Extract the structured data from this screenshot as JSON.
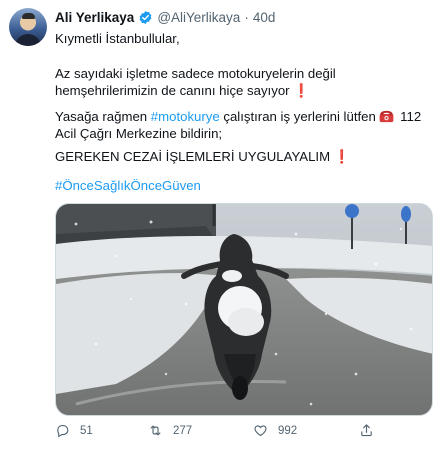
{
  "author": {
    "name": "Ali Yerlikaya",
    "handle": "@AliYerlikaya",
    "separator": "·",
    "time": "40d"
  },
  "tweet": {
    "greeting": "Kıymetli İstanbullular,",
    "para1": "Az sayıdaki işletme sadece motokuryelerin değil hemşehrilerimizin de canını hiçe sayıyor",
    "para2_pre": "Yasağa rağmen ",
    "para2_tag": "#motokurye",
    "para2_mid": " çalıştıran iş yerlerini lütfen ",
    "para2_post": " 112 Acil Çağrı Merkezine bildirin;",
    "para3": "GEREKEN CEZAİ İŞLEMLERİ UYGULAYALIM",
    "hashtag": "#ÖnceSağlıkÖnceGüven",
    "exclamation": "❗"
  },
  "actions": {
    "replies": "51",
    "retweets": "277",
    "likes": "992"
  },
  "colors": {
    "link": "#1d9bf0",
    "verified": "#1d9bf0",
    "muted": "#536471",
    "alert": "#e0302a"
  },
  "icons": [
    "verified-badge-icon",
    "telephone-icon",
    "reply-icon",
    "retweet-icon",
    "like-icon",
    "share-icon"
  ]
}
